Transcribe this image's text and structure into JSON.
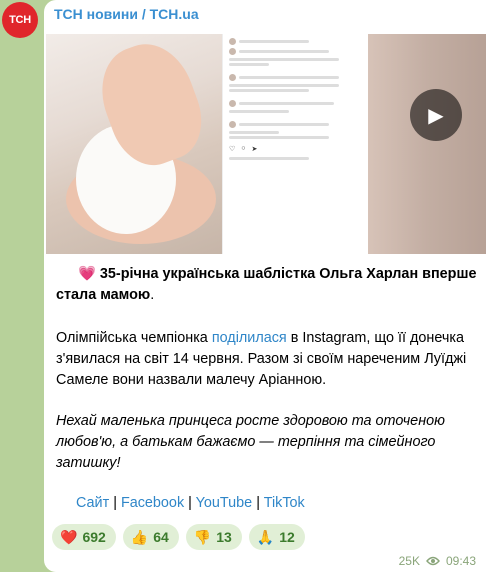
{
  "channel": {
    "name": "ТСН новини / TCH.ua",
    "avatar_text": "ТСН"
  },
  "post": {
    "headline_emoji": "💗",
    "headline": "35-річна українська шаблістка Ольга Харлан вперше стала мамою",
    "headline_end": ".",
    "para2_a": "Олімпійська чемпіонка ",
    "para2_link": "поділилася",
    "para2_b": " в Instagram, що її донечка з'явилася на світ 14 червня. Разом зі своїм нареченим Луїджі Самеле вони назвали малечу Аріанною.",
    "para3": "Нехай маленька принцеса росте здоровою та оточеною любов'ю, а батькам бажаємо — терпіння та сімейного затишку!"
  },
  "links": {
    "site": "Сайт",
    "facebook": "Facebook",
    "youtube": "YouTube",
    "tiktok": "TikTok",
    "separator": "|"
  },
  "reactions": [
    {
      "emoji": "❤️",
      "count": "692"
    },
    {
      "emoji": "👍",
      "count": "64"
    },
    {
      "emoji": "👎",
      "count": "13"
    },
    {
      "emoji": "🙏",
      "count": "12"
    }
  ],
  "meta": {
    "views": "25K",
    "time": "09:43"
  },
  "icons": {
    "play": "play-icon",
    "views": "eye-icon"
  }
}
